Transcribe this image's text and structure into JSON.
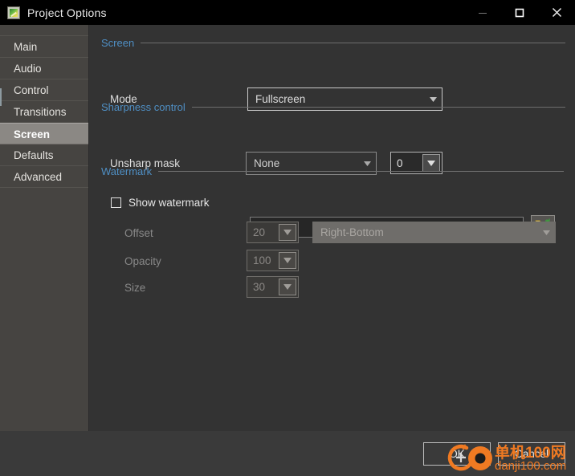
{
  "window": {
    "title": "Project Options",
    "icon": "picture-frame-icon",
    "controls": {
      "minimize": "minimize-icon",
      "maximize": "maximize-icon",
      "close": "close-icon"
    }
  },
  "sidebar": {
    "items": [
      {
        "label": "Main",
        "selected": false
      },
      {
        "label": "Audio",
        "selected": false
      },
      {
        "label": "Control",
        "selected": false
      },
      {
        "label": "Transitions",
        "selected": false
      },
      {
        "label": "Screen",
        "selected": true
      },
      {
        "label": "Defaults",
        "selected": false
      },
      {
        "label": "Advanced",
        "selected": false
      }
    ]
  },
  "groups": {
    "screen": {
      "title": "Screen"
    },
    "sharpness": {
      "title": "Sharpness control"
    },
    "watermark": {
      "title": "Watermark"
    }
  },
  "fields": {
    "mode": {
      "label": "Mode",
      "value": "Fullscreen"
    },
    "unsharp_mask": {
      "label": "Unsharp mask",
      "value": "None",
      "amount": "0"
    },
    "show_watermark": {
      "label": "Show watermark",
      "checked": false,
      "path_value": "",
      "path_placeholder": "",
      "browse_icon": "open-folder-icon"
    },
    "offset": {
      "label": "Offset",
      "value": "20",
      "position": "Right-Bottom",
      "disabled": true
    },
    "opacity": {
      "label": "Opacity",
      "value": "100",
      "disabled": true
    },
    "size": {
      "label": "Size",
      "value": "30",
      "disabled": true
    }
  },
  "footer": {
    "ok_label": "OK",
    "cancel_label": "Cancel"
  },
  "watermark_overlay": {
    "site_name": "单机100网",
    "site_url": "danji100.com",
    "color": "#f07a22"
  },
  "colors": {
    "accent_group": "#4f8fc4",
    "window_bg": "#333333",
    "sidebar_bg": "#464441",
    "sidebar_selected": "#8b8884",
    "titlebar_bg": "#000000"
  }
}
